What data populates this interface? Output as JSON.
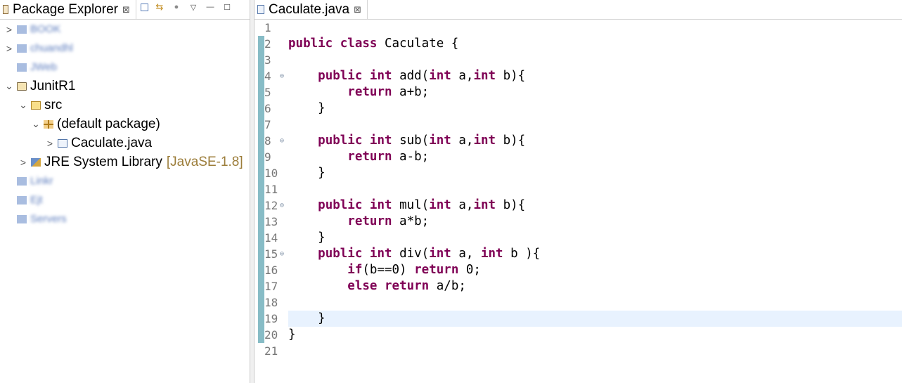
{
  "package_explorer": {
    "title": "Package Explorer",
    "close_glyph": "⊠",
    "toolbar_glyphs": {
      "link": "⇆",
      "focus": "●",
      "menu": "▽",
      "minimize": "—",
      "maximize": "☐"
    },
    "tree": [
      {
        "label": "BOOK",
        "blurred": true,
        "chevron": ">"
      },
      {
        "label": "chuandhl",
        "blurred": true,
        "chevron": ">"
      },
      {
        "label": "JWeb",
        "blurred": true,
        "chevron": ""
      },
      {
        "label": "JunitR1",
        "chevron": "⌄",
        "icon": "project-icon"
      },
      {
        "label": "src",
        "chevron": "⌄",
        "icon": "source-folder-icon",
        "indent": 1
      },
      {
        "label": "(default package)",
        "chevron": "⌄",
        "icon": "package-icon",
        "indent": 2
      },
      {
        "label": "Caculate.java",
        "chevron": ">",
        "icon": "java-file-icon",
        "indent": 3
      },
      {
        "label": "JRE System Library",
        "extra": "[JavaSE-1.8]",
        "chevron": ">",
        "icon": "library-icon",
        "indent": 1
      },
      {
        "label": "Linkr",
        "blurred": true,
        "chevron": ""
      },
      {
        "label": "Ejt",
        "blurred": true,
        "chevron": ""
      },
      {
        "label": "Servers",
        "blurred": true,
        "chevron": ""
      }
    ]
  },
  "editor": {
    "tab_title": "Caculate.java",
    "close_glyph": "⊠",
    "fold_glyph": "⊖",
    "current_line": 19,
    "lines": [
      {
        "num": "1",
        "tokens": []
      },
      {
        "num": "2",
        "tokens": [
          {
            "t": "public",
            "k": true
          },
          {
            "t": " "
          },
          {
            "t": "class",
            "k": true
          },
          {
            "t": " Caculate {"
          }
        ]
      },
      {
        "num": "3",
        "tokens": []
      },
      {
        "num": "4",
        "fold": true,
        "tokens": [
          {
            "t": "    "
          },
          {
            "t": "public",
            "k": true
          },
          {
            "t": " "
          },
          {
            "t": "int",
            "k": true
          },
          {
            "t": " add("
          },
          {
            "t": "int",
            "k": true
          },
          {
            "t": " a,"
          },
          {
            "t": "int",
            "k": true
          },
          {
            "t": " b){"
          }
        ]
      },
      {
        "num": "5",
        "tokens": [
          {
            "t": "        "
          },
          {
            "t": "return",
            "k": true
          },
          {
            "t": " a+b;"
          }
        ]
      },
      {
        "num": "6",
        "tokens": [
          {
            "t": "    }"
          }
        ]
      },
      {
        "num": "7",
        "tokens": []
      },
      {
        "num": "8",
        "fold": true,
        "tokens": [
          {
            "t": "    "
          },
          {
            "t": "public",
            "k": true
          },
          {
            "t": " "
          },
          {
            "t": "int",
            "k": true
          },
          {
            "t": " sub("
          },
          {
            "t": "int",
            "k": true
          },
          {
            "t": " a,"
          },
          {
            "t": "int",
            "k": true
          },
          {
            "t": " b){"
          }
        ]
      },
      {
        "num": "9",
        "tokens": [
          {
            "t": "        "
          },
          {
            "t": "return",
            "k": true
          },
          {
            "t": " a-b;"
          }
        ]
      },
      {
        "num": "10",
        "tokens": [
          {
            "t": "    }"
          }
        ]
      },
      {
        "num": "11",
        "tokens": []
      },
      {
        "num": "12",
        "fold": true,
        "tokens": [
          {
            "t": "    "
          },
          {
            "t": "public",
            "k": true
          },
          {
            "t": " "
          },
          {
            "t": "int",
            "k": true
          },
          {
            "t": " mul("
          },
          {
            "t": "int",
            "k": true
          },
          {
            "t": " a,"
          },
          {
            "t": "int",
            "k": true
          },
          {
            "t": " b){"
          }
        ]
      },
      {
        "num": "13",
        "tokens": [
          {
            "t": "        "
          },
          {
            "t": "return",
            "k": true
          },
          {
            "t": " a*b;"
          }
        ]
      },
      {
        "num": "14",
        "tokens": [
          {
            "t": "    }"
          }
        ]
      },
      {
        "num": "15",
        "fold": true,
        "tokens": [
          {
            "t": "    "
          },
          {
            "t": "public",
            "k": true
          },
          {
            "t": " "
          },
          {
            "t": "int",
            "k": true
          },
          {
            "t": " div("
          },
          {
            "t": "int",
            "k": true
          },
          {
            "t": " a, "
          },
          {
            "t": "int",
            "k": true
          },
          {
            "t": " b ){"
          }
        ]
      },
      {
        "num": "16",
        "tokens": [
          {
            "t": "        "
          },
          {
            "t": "if",
            "k": true
          },
          {
            "t": "(b==0) "
          },
          {
            "t": "return",
            "k": true
          },
          {
            "t": " 0;"
          }
        ]
      },
      {
        "num": "17",
        "tokens": [
          {
            "t": "        "
          },
          {
            "t": "else",
            "k": true
          },
          {
            "t": " "
          },
          {
            "t": "return",
            "k": true
          },
          {
            "t": " a/b;"
          }
        ]
      },
      {
        "num": "18",
        "tokens": []
      },
      {
        "num": "19",
        "tokens": [
          {
            "t": "    }"
          }
        ]
      },
      {
        "num": "20",
        "tokens": [
          {
            "t": "}"
          }
        ]
      },
      {
        "num": "21",
        "tokens": []
      }
    ]
  },
  "colors": {
    "keyword": "#7f0055",
    "line_number": "#787878",
    "current_line_bg": "#e8f2fe",
    "change_bar": "#87bcc6"
  }
}
